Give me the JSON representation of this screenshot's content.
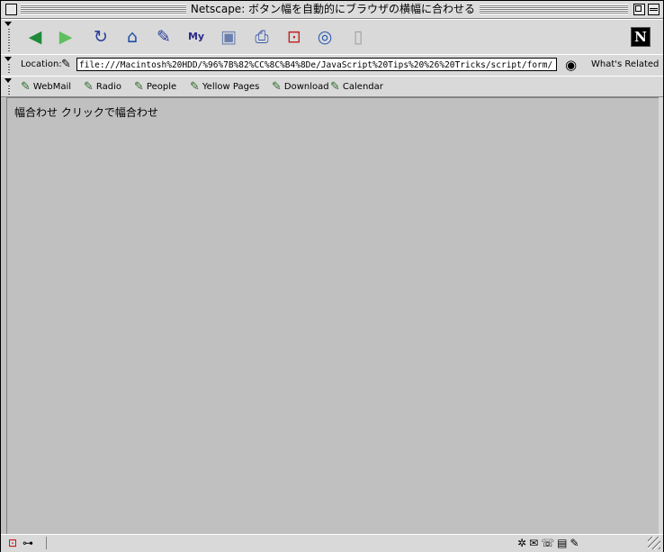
{
  "window": {
    "title": "Netscape: ボタン幅を自動的にブラウザの横幅に合わせる"
  },
  "navigation_toolbar": {
    "buttons": [
      {
        "name": "back",
        "icon": "back-arrow-icon",
        "glyph": "◆"
      },
      {
        "name": "forward",
        "icon": "forward-arrow-icon",
        "glyph": "◆"
      },
      {
        "name": "reload",
        "icon": "reload-icon",
        "glyph": "↻"
      },
      {
        "name": "home",
        "icon": "home-icon",
        "glyph": "⌂"
      },
      {
        "name": "search",
        "icon": "search-icon",
        "glyph": "✎"
      },
      {
        "name": "my-netscape",
        "icon": "my-netscape-icon",
        "glyph": "My"
      },
      {
        "name": "images",
        "icon": "images-icon",
        "glyph": "▣"
      },
      {
        "name": "print",
        "icon": "print-icon",
        "glyph": "⎙"
      },
      {
        "name": "security",
        "icon": "security-lock-icon",
        "glyph": "🔓"
      },
      {
        "name": "shop",
        "icon": "shop-icon",
        "glyph": "◎"
      },
      {
        "name": "stop",
        "icon": "stop-icon",
        "glyph": "▯"
      }
    ],
    "logo": "N"
  },
  "location_bar": {
    "label": "Location:",
    "url": "file:///Macintosh%20HDD/%96%7B%82%CC%8C%B4%8De/JavaScript%20Tips%20%26%20Tricks/script/form/",
    "related_label": "What's Related"
  },
  "personal_toolbar": {
    "items": [
      {
        "label": "WebMail"
      },
      {
        "label": "Radio"
      },
      {
        "label": "People"
      },
      {
        "label": "Yellow Pages"
      },
      {
        "label": "Download"
      },
      {
        "label": "Calendar"
      }
    ]
  },
  "content": {
    "text": "幅合わせ クリックで幅合わせ"
  },
  "colors": {
    "chrome": "#d9d9d9",
    "content_background": "#c0c0c0"
  }
}
